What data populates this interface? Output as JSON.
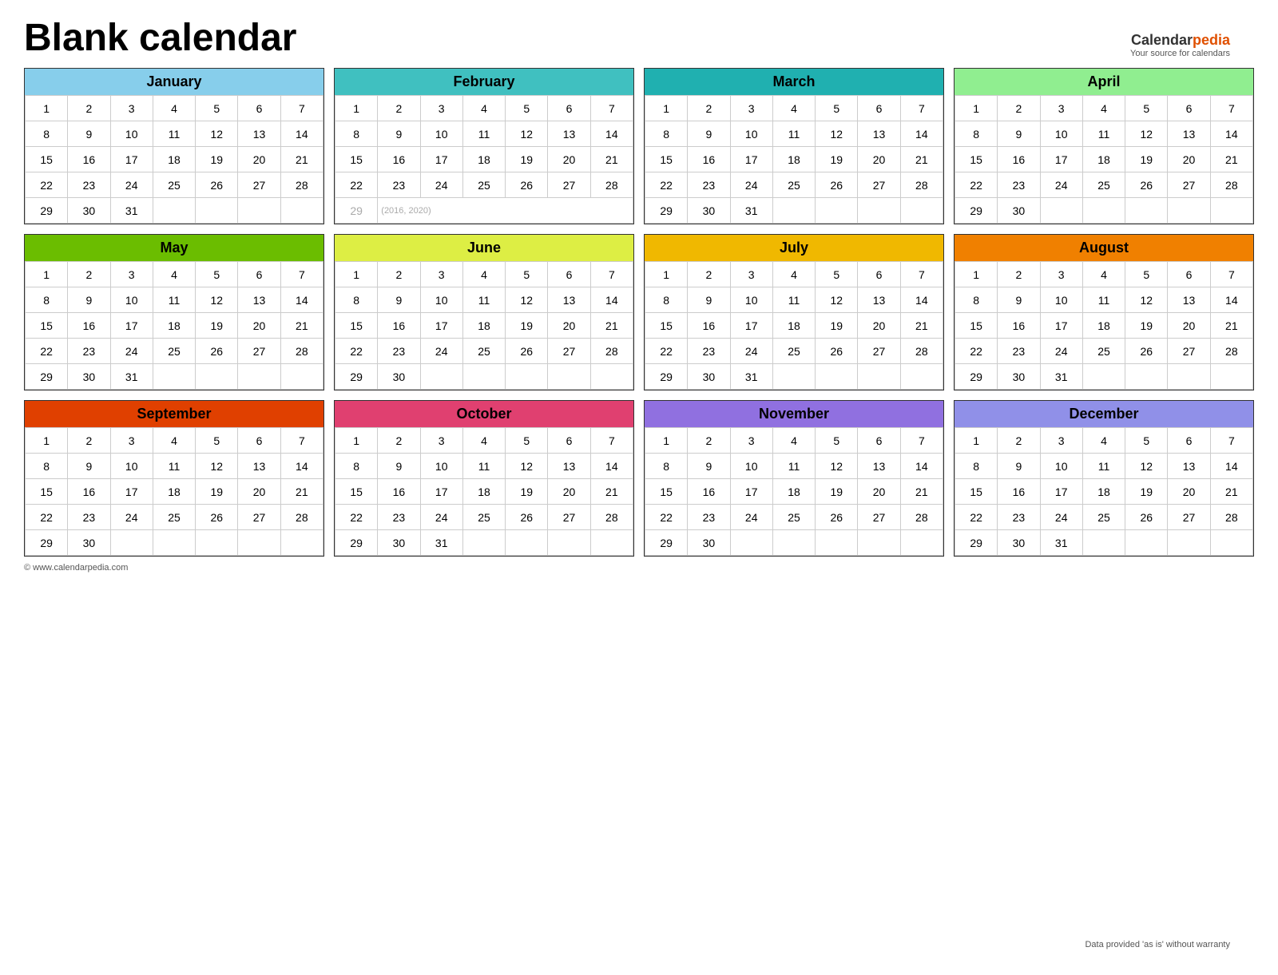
{
  "title": "Blank calendar",
  "logo": {
    "calendar": "Calendar",
    "pedia": "pedia",
    "subtitle": "Your source for calendars"
  },
  "footer_left": "© www.calendarpedia.com",
  "footer_right": "Data provided 'as is' without warranty",
  "months": [
    {
      "name": "January",
      "header_class": "jan-header",
      "weeks": [
        [
          1,
          2,
          3,
          4,
          5,
          6,
          7
        ],
        [
          8,
          9,
          10,
          11,
          12,
          13,
          14
        ],
        [
          15,
          16,
          17,
          18,
          19,
          20,
          21
        ],
        [
          22,
          23,
          24,
          25,
          26,
          27,
          28
        ],
        [
          29,
          30,
          31,
          null,
          null,
          null,
          null
        ]
      ],
      "extra_row": null
    },
    {
      "name": "February",
      "header_class": "feb-header",
      "weeks": [
        [
          1,
          2,
          3,
          4,
          5,
          6,
          7
        ],
        [
          8,
          9,
          10,
          11,
          12,
          13,
          14
        ],
        [
          15,
          16,
          17,
          18,
          19,
          20,
          21
        ],
        [
          22,
          23,
          24,
          25,
          26,
          27,
          28
        ]
      ],
      "extra_row": {
        "day": 29,
        "note": "(2016, 2020)"
      }
    },
    {
      "name": "March",
      "header_class": "mar-header",
      "weeks": [
        [
          1,
          2,
          3,
          4,
          5,
          6,
          7
        ],
        [
          8,
          9,
          10,
          11,
          12,
          13,
          14
        ],
        [
          15,
          16,
          17,
          18,
          19,
          20,
          21
        ],
        [
          22,
          23,
          24,
          25,
          26,
          27,
          28
        ],
        [
          29,
          30,
          31,
          null,
          null,
          null,
          null
        ]
      ],
      "extra_row": null
    },
    {
      "name": "April",
      "header_class": "apr-header",
      "weeks": [
        [
          1,
          2,
          3,
          4,
          5,
          6,
          7
        ],
        [
          8,
          9,
          10,
          11,
          12,
          13,
          14
        ],
        [
          15,
          16,
          17,
          18,
          19,
          20,
          21
        ],
        [
          22,
          23,
          24,
          25,
          26,
          27,
          28
        ],
        [
          29,
          30,
          null,
          null,
          null,
          null,
          null
        ]
      ],
      "extra_row": null
    },
    {
      "name": "May",
      "header_class": "may-header",
      "weeks": [
        [
          1,
          2,
          3,
          4,
          5,
          6,
          7
        ],
        [
          8,
          9,
          10,
          11,
          12,
          13,
          14
        ],
        [
          15,
          16,
          17,
          18,
          19,
          20,
          21
        ],
        [
          22,
          23,
          24,
          25,
          26,
          27,
          28
        ],
        [
          29,
          30,
          31,
          null,
          null,
          null,
          null
        ]
      ],
      "extra_row": null
    },
    {
      "name": "June",
      "header_class": "jun-header",
      "weeks": [
        [
          1,
          2,
          3,
          4,
          5,
          6,
          7
        ],
        [
          8,
          9,
          10,
          11,
          12,
          13,
          14
        ],
        [
          15,
          16,
          17,
          18,
          19,
          20,
          21
        ],
        [
          22,
          23,
          24,
          25,
          26,
          27,
          28
        ],
        [
          29,
          30,
          null,
          null,
          null,
          null,
          null
        ]
      ],
      "extra_row": null
    },
    {
      "name": "July",
      "header_class": "jul-header",
      "weeks": [
        [
          1,
          2,
          3,
          4,
          5,
          6,
          7
        ],
        [
          8,
          9,
          10,
          11,
          12,
          13,
          14
        ],
        [
          15,
          16,
          17,
          18,
          19,
          20,
          21
        ],
        [
          22,
          23,
          24,
          25,
          26,
          27,
          28
        ],
        [
          29,
          30,
          31,
          null,
          null,
          null,
          null
        ]
      ],
      "extra_row": null
    },
    {
      "name": "August",
      "header_class": "aug-header",
      "weeks": [
        [
          1,
          2,
          3,
          4,
          5,
          6,
          7
        ],
        [
          8,
          9,
          10,
          11,
          12,
          13,
          14
        ],
        [
          15,
          16,
          17,
          18,
          19,
          20,
          21
        ],
        [
          22,
          23,
          24,
          25,
          26,
          27,
          28
        ],
        [
          29,
          30,
          31,
          null,
          null,
          null,
          null
        ]
      ],
      "extra_row": null
    },
    {
      "name": "September",
      "header_class": "sep-header",
      "weeks": [
        [
          1,
          2,
          3,
          4,
          5,
          6,
          7
        ],
        [
          8,
          9,
          10,
          11,
          12,
          13,
          14
        ],
        [
          15,
          16,
          17,
          18,
          19,
          20,
          21
        ],
        [
          22,
          23,
          24,
          25,
          26,
          27,
          28
        ],
        [
          29,
          30,
          null,
          null,
          null,
          null,
          null
        ]
      ],
      "extra_row": null
    },
    {
      "name": "October",
      "header_class": "oct-header",
      "weeks": [
        [
          1,
          2,
          3,
          4,
          5,
          6,
          7
        ],
        [
          8,
          9,
          10,
          11,
          12,
          13,
          14
        ],
        [
          15,
          16,
          17,
          18,
          19,
          20,
          21
        ],
        [
          22,
          23,
          24,
          25,
          26,
          27,
          28
        ],
        [
          29,
          30,
          31,
          null,
          null,
          null,
          null
        ]
      ],
      "extra_row": null
    },
    {
      "name": "November",
      "header_class": "nov-header",
      "weeks": [
        [
          1,
          2,
          3,
          4,
          5,
          6,
          7
        ],
        [
          8,
          9,
          10,
          11,
          12,
          13,
          14
        ],
        [
          15,
          16,
          17,
          18,
          19,
          20,
          21
        ],
        [
          22,
          23,
          24,
          25,
          26,
          27,
          28
        ],
        [
          29,
          30,
          null,
          null,
          null,
          null,
          null
        ]
      ],
      "extra_row": null
    },
    {
      "name": "December",
      "header_class": "dec-header",
      "weeks": [
        [
          1,
          2,
          3,
          4,
          5,
          6,
          7
        ],
        [
          8,
          9,
          10,
          11,
          12,
          13,
          14
        ],
        [
          15,
          16,
          17,
          18,
          19,
          20,
          21
        ],
        [
          22,
          23,
          24,
          25,
          26,
          27,
          28
        ],
        [
          29,
          30,
          31,
          null,
          null,
          null,
          null
        ]
      ],
      "extra_row": null
    }
  ]
}
